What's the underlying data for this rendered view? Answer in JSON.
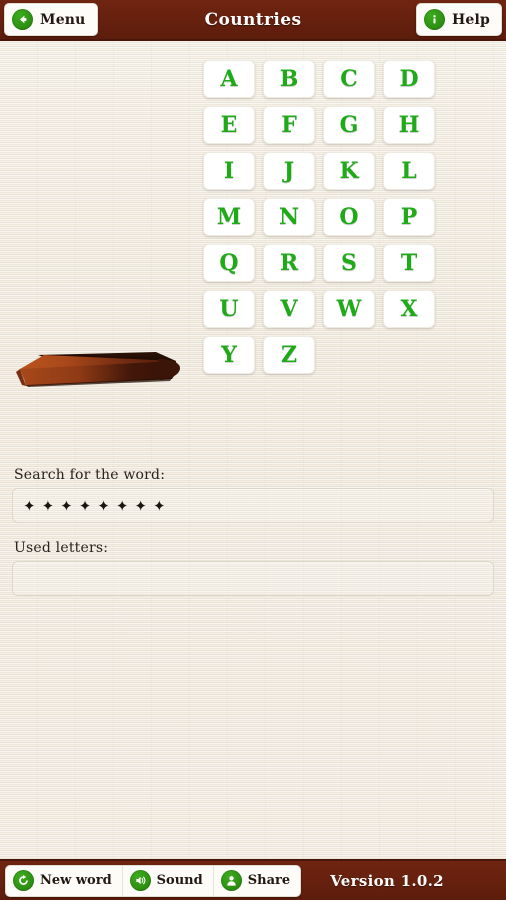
{
  "app": {
    "title": "Countries",
    "version_label": "Version 1.0.2",
    "accent_green": "#2e9113",
    "bar_maroon": "#66200e",
    "paper_bg": "#f2ece1",
    "letter_green": "#1faa18"
  },
  "header": {
    "menu_label": "Menu",
    "menu_icon": "back-arrow-icon",
    "title": "Countries",
    "help_label": "Help",
    "help_icon": "info-icon"
  },
  "keypad": {
    "letters": [
      "A",
      "B",
      "C",
      "D",
      "E",
      "F",
      "G",
      "H",
      "I",
      "J",
      "K",
      "L",
      "M",
      "N",
      "O",
      "P",
      "Q",
      "R",
      "S",
      "T",
      "U",
      "V",
      "W",
      "X",
      "Y",
      "Z"
    ]
  },
  "gallows": {
    "icon": "hangman-gallows-base",
    "stage": 0,
    "description": "wooden gallows base platform"
  },
  "form": {
    "word_label": "Search for the word:",
    "word_value": "✦✦✦✦✦✦✦✦",
    "word_placeholder": "",
    "word_letter_count": 8,
    "used_label": "Used letters:",
    "used_value": "",
    "used_placeholder": ""
  },
  "footer": {
    "new_word_label": "New word",
    "new_word_icon": "refresh-icon",
    "sound_label": "Sound",
    "sound_icon": "speaker-icon",
    "share_label": "Share",
    "share_icon": "person-icon",
    "version": "Version 1.0.2"
  }
}
